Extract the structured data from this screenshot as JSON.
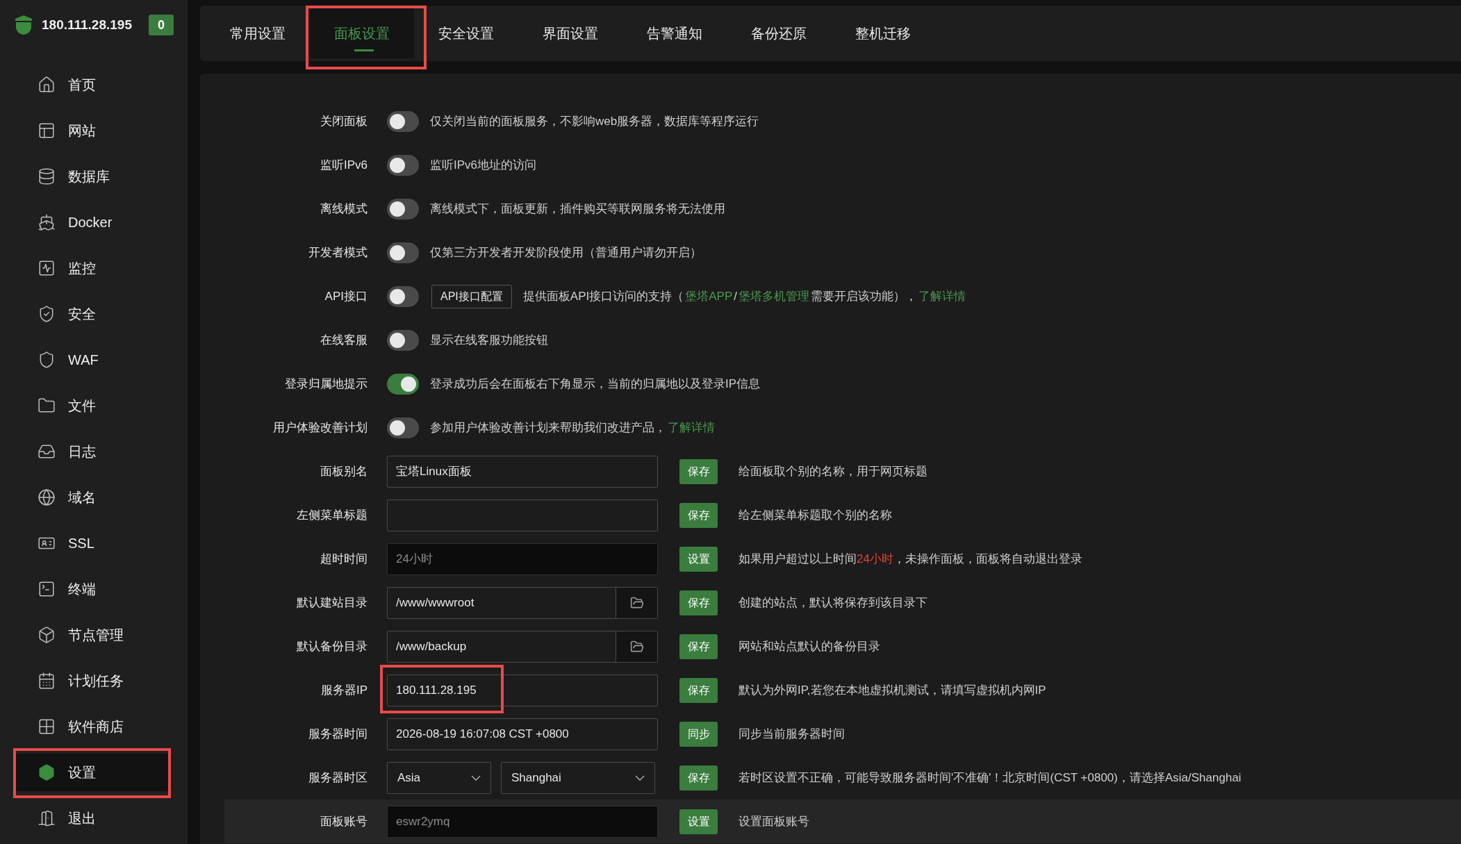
{
  "sidebar": {
    "host": "180.111.28.195",
    "badge": "0",
    "items": [
      {
        "kind": "home",
        "label": "首页",
        "selected": false,
        "highlighted": false
      },
      {
        "kind": "site",
        "label": "网站",
        "selected": false,
        "highlighted": false
      },
      {
        "kind": "database",
        "label": "数据库",
        "selected": false,
        "highlighted": false
      },
      {
        "kind": "docker",
        "label": "Docker",
        "selected": false,
        "highlighted": false
      },
      {
        "kind": "monitor",
        "label": "监控",
        "selected": false,
        "highlighted": false
      },
      {
        "kind": "security",
        "label": "安全",
        "selected": false,
        "highlighted": false
      },
      {
        "kind": "waf",
        "label": "WAF",
        "selected": false,
        "highlighted": false
      },
      {
        "kind": "files",
        "label": "文件",
        "selected": false,
        "highlighted": false
      },
      {
        "kind": "logs",
        "label": "日志",
        "selected": false,
        "highlighted": false
      },
      {
        "kind": "domain",
        "label": "域名",
        "selected": false,
        "highlighted": false
      },
      {
        "kind": "ssl",
        "label": "SSL",
        "selected": false,
        "highlighted": false
      },
      {
        "kind": "terminal",
        "label": "终端",
        "selected": false,
        "highlighted": false
      },
      {
        "kind": "nodes",
        "label": "节点管理",
        "selected": false,
        "highlighted": false
      },
      {
        "kind": "cron",
        "label": "计划任务",
        "selected": false,
        "highlighted": false
      },
      {
        "kind": "store",
        "label": "软件商店",
        "selected": false,
        "highlighted": false
      },
      {
        "kind": "settings",
        "label": "设置",
        "selected": true,
        "highlighted": true
      },
      {
        "kind": "logout",
        "label": "退出",
        "selected": false,
        "highlighted": false
      }
    ]
  },
  "tabs": [
    {
      "label": "常用设置",
      "selected": false,
      "highlighted": false
    },
    {
      "label": "面板设置",
      "selected": true,
      "highlighted": true
    },
    {
      "label": "安全设置",
      "selected": false,
      "highlighted": false
    },
    {
      "label": "界面设置",
      "selected": false,
      "highlighted": false
    },
    {
      "label": "告警通知",
      "selected": false,
      "highlighted": false
    },
    {
      "label": "备份还原",
      "selected": false,
      "highlighted": false
    },
    {
      "label": "整机迁移",
      "selected": false,
      "highlighted": false
    }
  ],
  "settings": [
    {
      "kind": "toggle",
      "label": "关闭面板",
      "on": false,
      "description": [
        {
          "kind": "text",
          "text": "仅关闭当前的面板服务，不影响web服务器，数据库等程序运行"
        }
      ]
    },
    {
      "kind": "toggle",
      "label": "监听IPv6",
      "on": false,
      "description": [
        {
          "kind": "text",
          "text": "监听IPv6地址的访问"
        }
      ]
    },
    {
      "kind": "toggle",
      "label": "离线模式",
      "on": false,
      "description": [
        {
          "kind": "text",
          "text": "离线模式下，面板更新，插件购买等联网服务将无法使用"
        }
      ]
    },
    {
      "kind": "toggle",
      "label": "开发者模式",
      "on": false,
      "description": [
        {
          "kind": "text",
          "text": "仅第三方开发者开发阶段使用（普通用户请勿开启）"
        }
      ]
    },
    {
      "kind": "toggle",
      "label": "API接口",
      "on": false,
      "extra_button": "API接口配置",
      "description": [
        {
          "kind": "text",
          "text": "提供面板API接口访问的支持（"
        },
        {
          "kind": "link",
          "text": "堡塔APP"
        },
        {
          "kind": "text",
          "text": "/"
        },
        {
          "kind": "link",
          "text": "堡塔多机管理"
        },
        {
          "kind": "text",
          "text": "需要开启该功能），"
        },
        {
          "kind": "link",
          "text": "了解详情"
        }
      ]
    },
    {
      "kind": "toggle",
      "label": "在线客服",
      "on": false,
      "description": [
        {
          "kind": "text",
          "text": "显示在线客服功能按钮"
        }
      ]
    },
    {
      "kind": "toggle",
      "label": "登录归属地提示",
      "on": true,
      "description": [
        {
          "kind": "text",
          "text": "登录成功后会在面板右下角显示，当前的归属地以及登录IP信息"
        }
      ]
    },
    {
      "kind": "toggle",
      "label": "用户体验改善计划",
      "on": false,
      "description": [
        {
          "kind": "text",
          "text": "参加用户体验改善计划来帮助我们改进产品，"
        },
        {
          "kind": "link",
          "text": "了解详情"
        }
      ]
    },
    {
      "kind": "input",
      "label": "面板别名",
      "value": "宝塔Linux面板",
      "readonly": false,
      "highlighted": false,
      "button": "保存",
      "description": [
        {
          "kind": "text",
          "text": "给面板取个别的名称，用于网页标题"
        }
      ]
    },
    {
      "kind": "input",
      "label": "左侧菜单标题",
      "readonly": false,
      "highlighted": false,
      "button": "保存",
      "description": [
        {
          "kind": "text",
          "text": "给左侧菜单标题取个别的名称"
        }
      ]
    },
    {
      "kind": "input",
      "label": "超时时间",
      "value": "24小时",
      "readonly": true,
      "highlighted": false,
      "button": "设置",
      "description": [
        {
          "kind": "text",
          "text": "如果用户超过以上时间"
        },
        {
          "kind": "warn",
          "text": "24小时"
        },
        {
          "kind": "text",
          "text": "，未操作面板，面板将自动退出登录"
        }
      ]
    },
    {
      "kind": "path",
      "label": "默认建站目录",
      "value": "/www/wwwroot",
      "button": "保存",
      "description": [
        {
          "kind": "text",
          "text": "创建的站点，默认将保存到该目录下"
        }
      ]
    },
    {
      "kind": "path",
      "label": "默认备份目录",
      "value": "/www/backup",
      "button": "保存",
      "description": [
        {
          "kind": "text",
          "text": "网站和站点默认的备份目录"
        }
      ]
    },
    {
      "kind": "input",
      "label": "服务器IP",
      "value": "180.111.28.195",
      "readonly": false,
      "highlighted": true,
      "button": "保存",
      "description": [
        {
          "kind": "text",
          "text": "默认为外网IP,若您在本地虚拟机测试，请填写虚拟机内网IP"
        }
      ]
    },
    {
      "kind": "input",
      "label": "服务器时间",
      "value": "2026-08-19 16:07:08 CST +0800",
      "readonly": false,
      "highlighted": false,
      "button": "同步",
      "description": [
        {
          "kind": "text",
          "text": "同步当前服务器时间"
        }
      ]
    },
    {
      "kind": "selects",
      "label": "服务器时区",
      "region": "Asia",
      "city": "Shanghai",
      "button": "保存",
      "description": [
        {
          "kind": "text",
          "text": "若时区设置不正确，可能导致服务器时间'不准确'！北京时间(CST +0800)，请选择Asia/Shanghai"
        }
      ]
    },
    {
      "kind": "input",
      "label": "面板账号",
      "value": "eswr2ymq",
      "readonly": true,
      "highlighted": false,
      "hovered": true,
      "button": "设置",
      "description": [
        {
          "kind": "text",
          "text": "设置面板账号"
        }
      ]
    }
  ]
}
